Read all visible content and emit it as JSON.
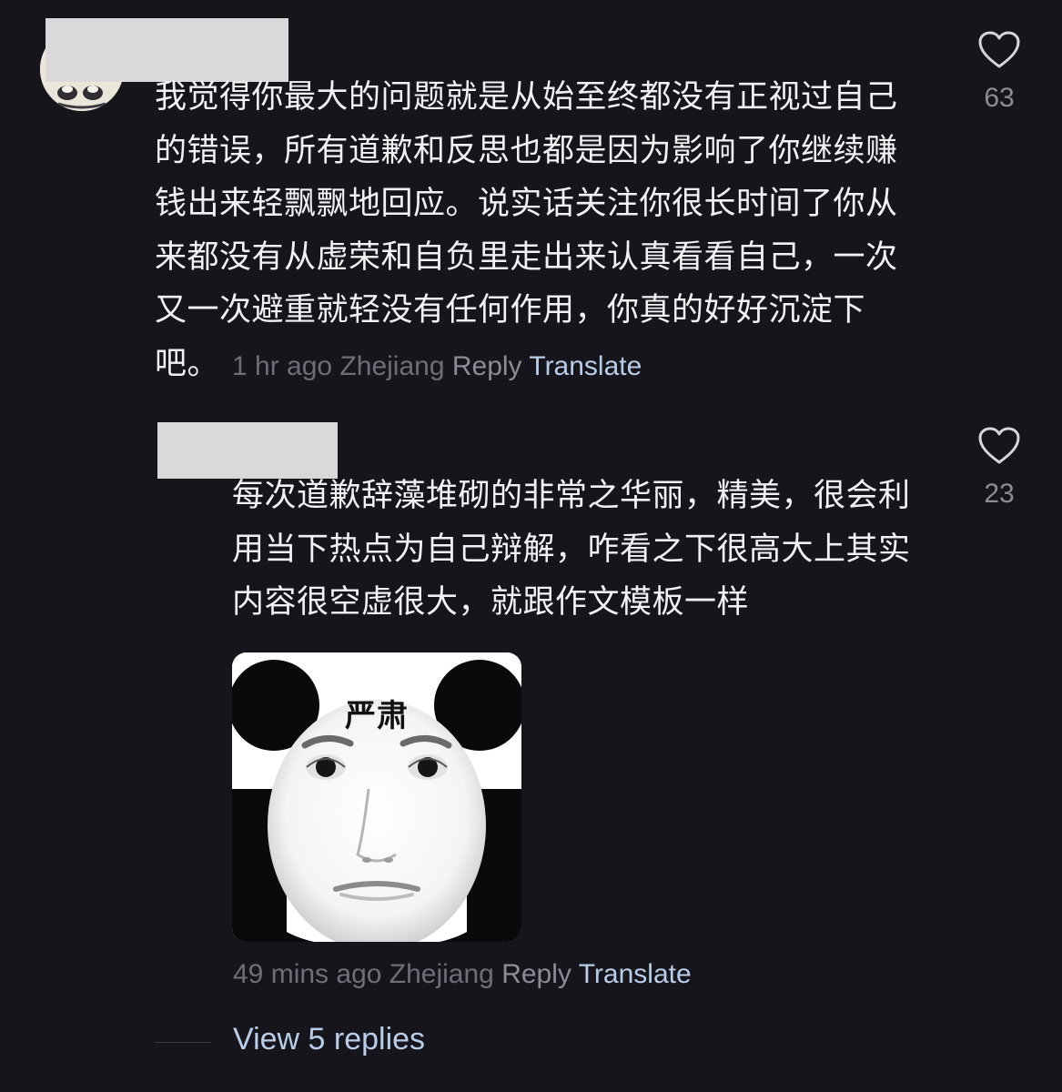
{
  "comments": [
    {
      "text": "我觉得你最大的问题就是从始至终都没有正视过自己的错误，所有道歉和反思也都是因为影响了你继续赚钱出来轻飘飘地回应。说实话关注你很长时间了你从来都没有从虚荣和自负里走出来认真看看自己，一次又一次避重就轻没有任何作用，你真的好好沉淀下吧。",
      "time": "1 hr ago",
      "location": "Zhejiang",
      "reply_label": "Reply",
      "translate_label": "Translate",
      "likes": "63",
      "icon": "heart-outline-icon"
    },
    {
      "text": "每次道歉辞藻堆砌的非常之华丽，精美，很会利用当下热点为自己辩解，咋看之下很高大上其实内容很空虚很大，就跟作文模板一样",
      "sticker_caption": "严肃",
      "time": "49 mins ago",
      "location": "Zhejiang",
      "reply_label": "Reply",
      "translate_label": "Translate",
      "likes": "23",
      "icon": "heart-outline-icon"
    }
  ],
  "view_replies_label": "View 5 replies",
  "colors": {
    "background": "#16151c",
    "text": "#f2f2f4",
    "meta_grey": "#6f6e76",
    "action_grey": "#8d8c94",
    "link_blue": "#b8cde8",
    "redaction": "#d9d9d9"
  }
}
